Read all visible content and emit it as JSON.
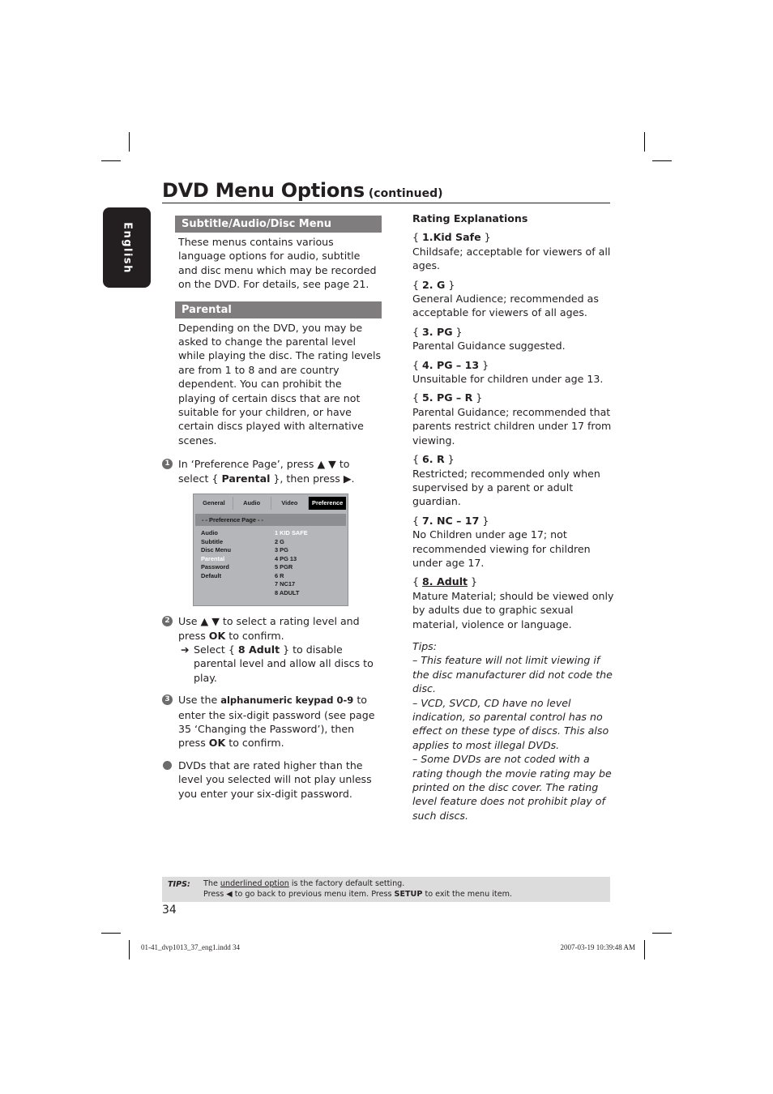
{
  "sidebar_tab": "English",
  "title": {
    "main": "DVD Menu Options",
    "continued": "(continued)"
  },
  "left": {
    "section1": {
      "heading": "Subtitle/Audio/Disc Menu",
      "body": "These menus contains various language options for audio, subtitle and disc menu which may be recorded on the DVD. For details, see page 21."
    },
    "section2": {
      "heading": "Parental",
      "body": "Depending on the DVD, you may be asked to change the parental level while playing the disc. The rating levels are from 1 to 8 and are country dependent. You can prohibit the playing of certain discs that are not suitable for your children, or have certain discs played with alternative scenes."
    },
    "step1": {
      "num": "1",
      "t1": "In ‘Preference Page’, press ▲ ▼ to select { ",
      "bold": "Parental",
      "t2": " }, then press ▶."
    },
    "osd": {
      "tabs": [
        "General",
        "Audio",
        "Video",
        "Preference"
      ],
      "active_tab": "Preference",
      "page_title": "- -   Preference Page   - -",
      "menu_items": [
        "Audio",
        "Subtitle",
        "Disc Menu",
        "Parental",
        "Password",
        "Default"
      ],
      "selected_item": "Parental",
      "options": [
        "1 KID SAFE",
        "2 G",
        "3 PG",
        "4 PG 13",
        "5 PGR",
        "6 R",
        "7 NC17",
        "8 ADULT"
      ],
      "highlighted_option": "1 KID SAFE"
    },
    "step2": {
      "num": "2",
      "t1": "Use ▲ ▼ to select a rating level and press ",
      "bold": "OK",
      "t2": " to confirm.",
      "arrow": "➔",
      "sub_t1": "Select { ",
      "sub_bold": "8 Adult",
      "sub_t2": " } to disable parental level and allow all discs to play."
    },
    "step3": {
      "num": "3",
      "t1": "Use the ",
      "bold1": "alphanumeric keypad 0-9",
      "t2": " to enter the six-digit password (see page 35 ‘Changing the Password’), then press ",
      "bold2": "OK",
      "t3": " to confirm."
    },
    "bullet": "DVDs that are rated higher than the level you selected will not play unless you enter your six-digit password."
  },
  "right": {
    "heading": "Rating Explanations",
    "ratings": [
      {
        "label": "1.Kid Safe",
        "desc": "Childsafe; acceptable for viewers of all ages."
      },
      {
        "label": "2. G",
        "desc": "General Audience; recommended as acceptable for viewers of all ages."
      },
      {
        "label": "3. PG",
        "desc": "Parental Guidance suggested."
      },
      {
        "label": "4. PG – 13",
        "desc": "Unsuitable for children under age 13."
      },
      {
        "label": "5. PG – R",
        "desc": "Parental Guidance; recommended that parents restrict children under 17 from viewing."
      },
      {
        "label": "6. R",
        "desc": "Restricted; recommended only when supervised by a parent or adult guardian."
      },
      {
        "label": "7. NC – 17",
        "desc": "No Children under age 17; not recommended viewing for children under age 17."
      },
      {
        "label": "8. Adult",
        "desc": "Mature Material; should be viewed only by adults due to graphic sexual material, violence or language."
      }
    ],
    "tips_heading": "Tips:",
    "tips": [
      "–  This feature will not limit viewing if the disc manufacturer did not code the disc.",
      "–  VCD, SVCD, CD have no level indication, so parental control has no effect on these type of discs. This also applies to most illegal DVDs.",
      "–  Some DVDs are not coded with a rating though the movie rating may be printed on the disc cover. The rating level feature does not prohibit play of such discs."
    ]
  },
  "tips_bar": {
    "label": "TIPS:",
    "l1_a": "The ",
    "l1_u": "underlined option",
    "l1_b": " is the factory default setting.",
    "l2_a": "Press  ◀ to go back to previous menu item. Press ",
    "l2_bold": "SETUP",
    "l2_b": " to exit the menu item."
  },
  "page_number": "34",
  "slug": {
    "file": "01-41_dvp1013_37_eng1.indd   34",
    "timestamp": "2007-03-19   10:39:48 AM"
  }
}
